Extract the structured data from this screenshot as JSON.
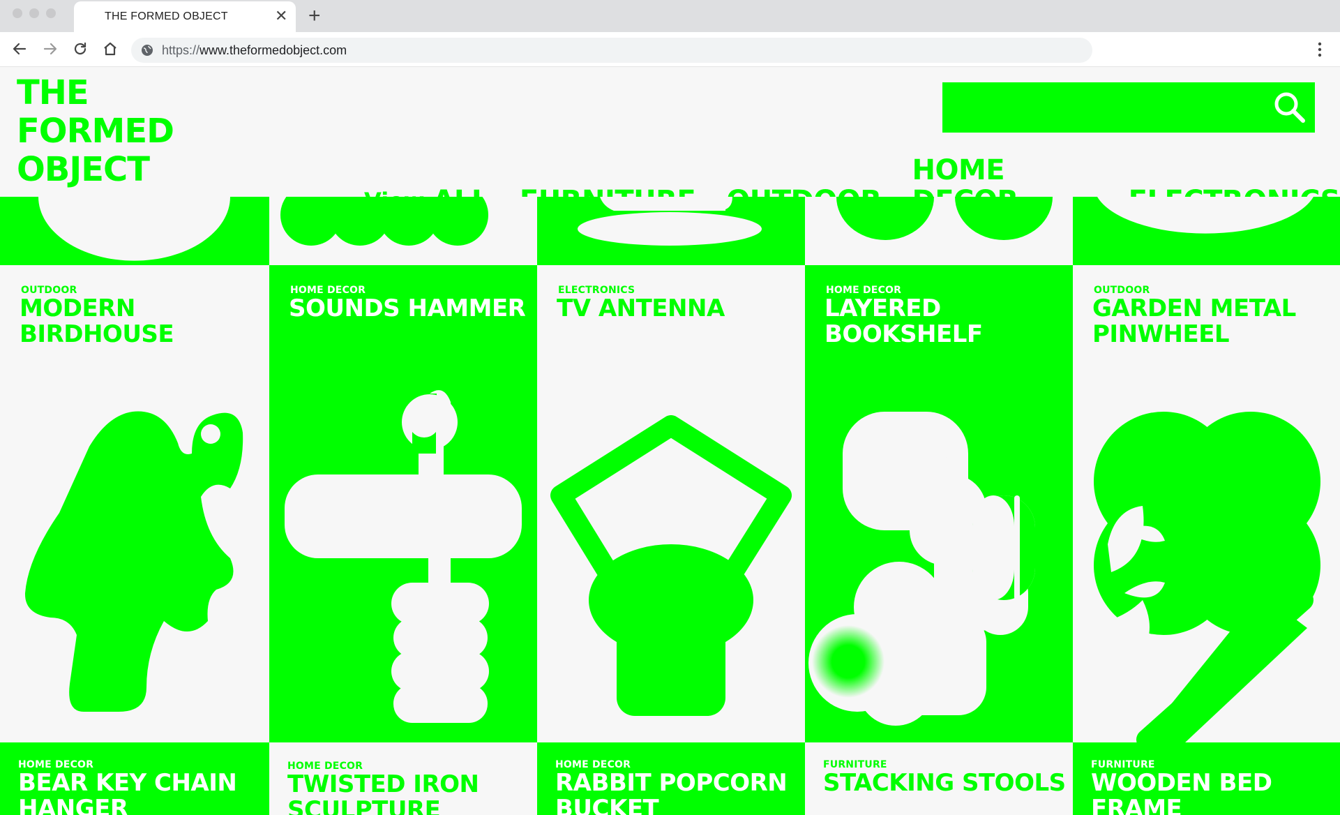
{
  "browser": {
    "tab_title": "THE FORMED OBJECT",
    "url_scheme": "https://",
    "url_host": "www.theformedobject.com"
  },
  "site": {
    "logo_lines": [
      "THE",
      "FORMED",
      "OBJECT"
    ],
    "accent_color": "#00ff00",
    "background_color": "#f7f7f7"
  },
  "nav": {
    "view_label": "View",
    "items": [
      "ALL",
      "FURNITURE",
      "OUTDOOR",
      "HOME DECOR",
      "ELECTRONICS"
    ],
    "active": "ALL"
  },
  "products": [
    {
      "category": "OUTDOOR",
      "name": "MODERN BIRDHOUSE",
      "icon": "birdhouse-shape"
    },
    {
      "category": "HOME DECOR",
      "name": "SOUNDS HAMMER",
      "icon": "hammer-shape"
    },
    {
      "category": "ELECTRONICS",
      "name": "TV ANTENNA",
      "icon": "antenna-shape"
    },
    {
      "category": "HOME DECOR",
      "name": "LAYERED BOOKSHELF",
      "icon": "bookshelf-shape"
    },
    {
      "category": "OUTDOOR",
      "name": "GARDEN METAL PINWHEEL",
      "icon": "pinwheel-shape"
    }
  ],
  "next_row": [
    {
      "category": "HOME DECOR",
      "name": "BEAR KEY CHAIN HANGER"
    },
    {
      "category": "HOME DECOR",
      "name": "TWISTED IRON SCULPTURE"
    },
    {
      "category": "HOME DECOR",
      "name": "RABBIT POPCORN BUCKET"
    },
    {
      "category": "FURNITURE",
      "name": "STACKING STOOLS"
    },
    {
      "category": "FURNITURE",
      "name": "WOODEN BED FRAME"
    }
  ]
}
